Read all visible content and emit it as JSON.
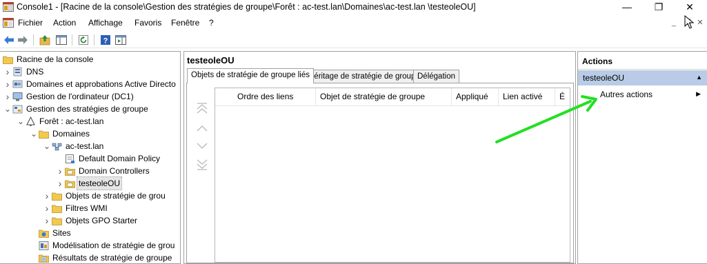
{
  "window": {
    "title": "Console1 - [Racine de la console\\Gestion des stratégies de groupe\\Forêt : ac-test.lan\\Domaines\\ac-test.lan \\testeoleOU]",
    "minimize_glyph": "—",
    "maximize_glyph": "❐",
    "close_glyph": "✕"
  },
  "menu": {
    "items": [
      "Fichier",
      "Action",
      "Affichage",
      "Favoris",
      "Fenêtre",
      "?"
    ],
    "mdi_minimize": "_",
    "mdi_restore": "❐",
    "mdi_close": "✕"
  },
  "toolbar": {
    "buttons": [
      "back-icon",
      "forward-icon",
      "up-folder-icon",
      "show-hide-tree-icon",
      "refresh-icon",
      "help-icon",
      "show-hide-action-pane-icon"
    ]
  },
  "tree": {
    "items": [
      {
        "label": "Racine de la console",
        "icon": "folder-icon",
        "expander": ""
      },
      {
        "label": "DNS",
        "icon": "dns-icon",
        "expander": "›"
      },
      {
        "label": "Domaines et approbations Active Directo",
        "icon": "domains-icon",
        "expander": "›"
      },
      {
        "label": "Gestion de l'ordinateur (DC1)",
        "icon": "computer-icon",
        "expander": "›"
      },
      {
        "label": "Gestion des stratégies de groupe",
        "icon": "gpo-management-icon",
        "expander": "⌄"
      },
      {
        "label": "Forêt : ac-test.lan",
        "icon": "forest-icon",
        "expander": "⌄"
      },
      {
        "label": "Domaines",
        "icon": "folder-icon",
        "expander": "⌄"
      },
      {
        "label": "ac-test.lan",
        "icon": "domain-icon",
        "expander": "⌄"
      },
      {
        "label": "Default Domain Policy",
        "icon": "gpo-link-icon",
        "expander": ""
      },
      {
        "label": "Domain Controllers",
        "icon": "ou-icon",
        "expander": "›"
      },
      {
        "label": "testeoleOU",
        "icon": "ou-icon",
        "expander": "›"
      },
      {
        "label": "Objets de stratégie de grou",
        "icon": "folder-icon",
        "expander": "›"
      },
      {
        "label": "Filtres WMI",
        "icon": "folder-icon",
        "expander": "›"
      },
      {
        "label": "Objets GPO Starter",
        "icon": "folder-icon",
        "expander": "›"
      },
      {
        "label": "Sites",
        "icon": "sites-icon",
        "expander": ""
      },
      {
        "label": "Modélisation de stratégie de grou",
        "icon": "modeling-icon",
        "expander": ""
      },
      {
        "label": "Résultats de stratégie de groupe",
        "icon": "results-icon",
        "expander": ""
      }
    ]
  },
  "center": {
    "header": "testeoleOU",
    "tabs": [
      "Objets de stratégie de groupe liés",
      "Héritage de stratégie de groupe",
      "Délégation"
    ],
    "active_tab": "Objets de stratégie de groupe liés",
    "columns": [
      "Ordre des liens",
      "Objet de stratégie de groupe",
      "Appliqué",
      "Lien activé",
      "É"
    ]
  },
  "actions": {
    "title": "Actions",
    "group": "testeoleOU",
    "group_caret": "▲",
    "item": "Autres actions",
    "item_caret": "▶"
  },
  "colors": {
    "selection_header": "#b9cbe6",
    "annotation_arrow": "#22e022"
  }
}
